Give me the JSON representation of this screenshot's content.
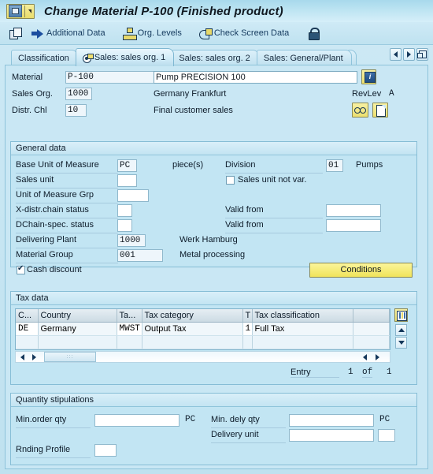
{
  "window": {
    "title": "Change Material P-100 (Finished product)",
    "system_menu_icon": "sap-logo-icon"
  },
  "toolbar": {
    "items": [
      {
        "label": "",
        "icon": "copy-icon",
        "name": "copy-button"
      },
      {
        "label": "Additional Data",
        "icon": "right-arrow-icon",
        "name": "additional-data-button"
      },
      {
        "label": "Org. Levels",
        "icon": "org-levels-icon",
        "name": "org-levels-button"
      },
      {
        "label": "Check Screen Data",
        "icon": "check-screen-icon",
        "name": "check-screen-data-button"
      },
      {
        "label": "",
        "icon": "lock-icon",
        "name": "lock-button"
      }
    ]
  },
  "tabs": {
    "items": [
      {
        "label": "Classification",
        "active": false
      },
      {
        "label": "Sales: sales org. 1",
        "active": true
      },
      {
        "label": "Sales: sales org. 2",
        "active": false
      },
      {
        "label": "Sales: General/Plant",
        "active": false
      }
    ],
    "nav": {
      "prev_icon": "left-arrow-icon",
      "next_icon": "right-arrow-icon",
      "list_icon": "tab-list-icon"
    }
  },
  "header": {
    "material_label": "Material",
    "material_value": "P-100",
    "material_desc": "Pump PRECISION 100",
    "info_icon": "info-icon",
    "sales_org_label": "Sales Org.",
    "sales_org_value": "1000",
    "sales_org_text": "Germany Frankfurt",
    "revlev_label": "RevLev",
    "revlev_value": "A",
    "distr_chl_label": "Distr. Chl",
    "distr_chl_value": "10",
    "distr_chl_text": "Final customer sales",
    "glasses_icon": "glasses-icon",
    "page_icon": "page-icon"
  },
  "general_data": {
    "title": "General data",
    "base_uom_label": "Base Unit of Measure",
    "base_uom_value": "PC",
    "base_uom_text": "piece(s)",
    "division_label": "Division",
    "division_value": "01",
    "division_text": "Pumps",
    "sales_unit_label": "Sales unit",
    "sales_unit_value": "",
    "sales_unit_not_var_label": "Sales unit not var.",
    "sales_unit_not_var_checked": false,
    "uom_grp_label": "Unit of Measure Grp",
    "uom_grp_value": "",
    "xdistr_label": "X-distr.chain status",
    "xdistr_value": "",
    "valid_from_1_label": "Valid from",
    "valid_from_1_value": "",
    "dchain_label": "DChain-spec. status",
    "dchain_value": "",
    "valid_from_2_label": "Valid from",
    "valid_from_2_value": "",
    "delivering_plant_label": "Delivering Plant",
    "delivering_plant_value": "1000",
    "delivering_plant_text": "Werk Hamburg",
    "material_group_label": "Material Group",
    "material_group_value": "001",
    "material_group_text": "Metal processing",
    "cash_discount_label": "Cash discount",
    "cash_discount_checked": true,
    "conditions_button": "Conditions"
  },
  "tax_data": {
    "title": "Tax data",
    "columns": [
      "C...",
      "Country",
      "Ta...",
      "Tax category",
      "T",
      "Tax classification",
      ""
    ],
    "rows": [
      [
        "DE",
        "Germany",
        "MWST",
        "Output Tax",
        "1",
        "Full Tax",
        ""
      ],
      [
        "",
        "",
        "",
        "",
        "",
        "",
        ""
      ]
    ],
    "grid_config_icon": "grid-config-icon",
    "scroll_up_icon": "scroll-up-icon",
    "scroll_down_icon": "scroll-down-icon",
    "hscroll_left_icon": "hscroll-left-icon",
    "hscroll_right_icon": "hscroll-right-icon",
    "entry_label": "Entry",
    "entry_current": "1",
    "entry_of": "of",
    "entry_total": "1"
  },
  "quantity_stipulations": {
    "title": "Quantity stipulations",
    "min_order_qty_label": "Min.order qty",
    "min_order_qty_value": "",
    "min_order_qty_unit": "PC",
    "min_dely_qty_label": "Min. dely qty",
    "min_dely_qty_value": "",
    "min_dely_qty_unit": "PC",
    "delivery_unit_label": "Delivery unit",
    "delivery_unit_value": "",
    "delivery_unit_unit": "",
    "rnding_profile_label": "Rnding Profile",
    "rnding_profile_value": ""
  },
  "colors": {
    "background": "#c9e7f4",
    "titlebar": "#bde4f2",
    "accent_yellow": "#f0e45a",
    "text": "#0d1b29",
    "field_border": "#8fb8cc"
  }
}
